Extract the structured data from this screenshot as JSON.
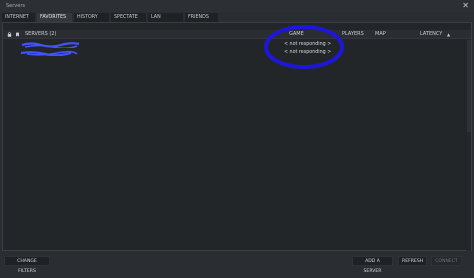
{
  "window": {
    "title": "Servers",
    "close_glyph": "✕"
  },
  "tabs": [
    {
      "label": "INTERNET",
      "active": false
    },
    {
      "label": "FAVORITES",
      "active": true
    },
    {
      "label": "HISTORY",
      "active": false
    },
    {
      "label": "SPECTATE",
      "active": false
    },
    {
      "label": "LAN",
      "active": false
    },
    {
      "label": "FRIENDS",
      "active": false
    }
  ],
  "columns": {
    "servers": "SERVERS (2)",
    "game": "GAME",
    "players": "PLAYERS",
    "map": "MAP",
    "latency": "LATENCY",
    "latency_sort": "▲"
  },
  "rows": [
    {
      "server_redacted": true,
      "game": "< not responding >"
    },
    {
      "server_redacted": true,
      "game": "< not responding >"
    }
  ],
  "buttons": {
    "change_filters": "CHANGE FILTERS",
    "add_server": "ADD A SERVER",
    "refresh": "REFRESH",
    "connect": "CONNECT"
  },
  "colors": {
    "annotation": "#1e17d8",
    "redaction": "#3f54ff"
  }
}
